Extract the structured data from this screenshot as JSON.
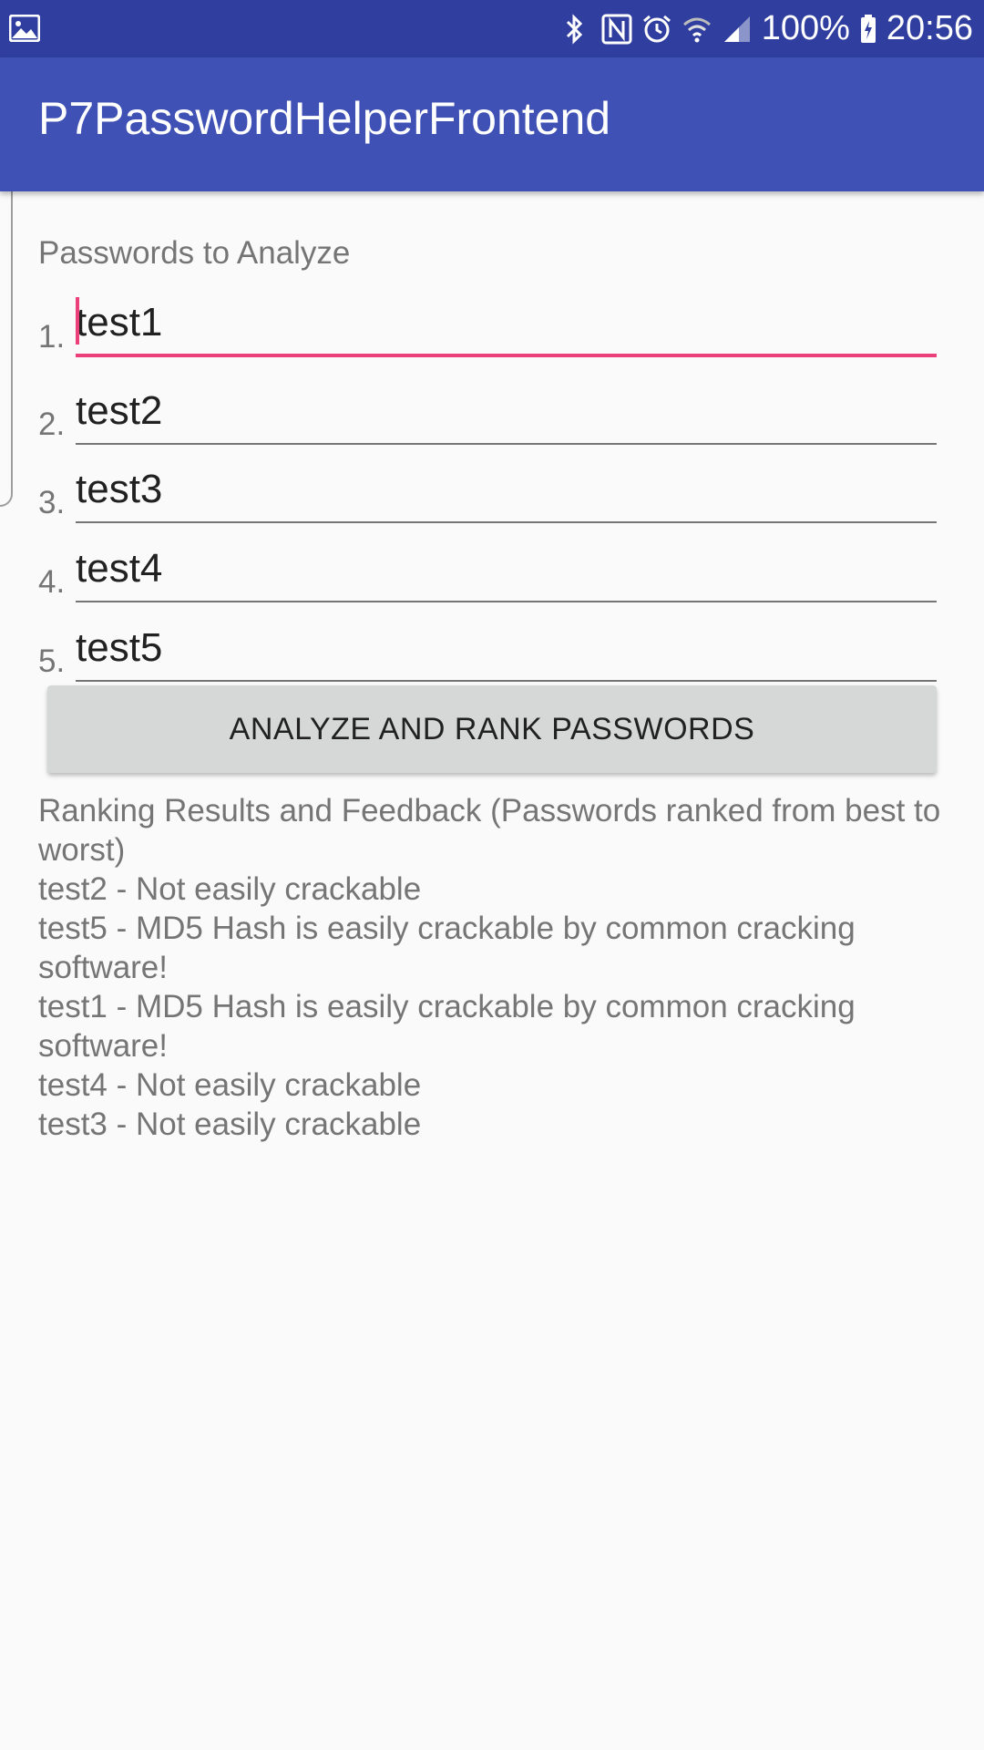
{
  "status_bar": {
    "battery": "100%",
    "time": "20:56",
    "left_icon": "image-icon",
    "icons": [
      "bluetooth-icon",
      "nfc-icon",
      "alarm-icon",
      "wifi-icon",
      "signal-icon",
      "battery-charging-icon"
    ]
  },
  "app_bar": {
    "title": "P7PasswordHelperFrontend"
  },
  "form": {
    "section_label": "Passwords to Analyze",
    "passwords": [
      {
        "number": "1.",
        "value": "test1"
      },
      {
        "number": "2.",
        "value": "test2"
      },
      {
        "number": "3.",
        "value": "test3"
      },
      {
        "number": "4.",
        "value": "test4"
      },
      {
        "number": "5.",
        "value": "test5"
      }
    ],
    "analyze_label": "ANALYZE AND RANK PASSWORDS"
  },
  "results": {
    "heading": "Ranking Results and Feedback (Passwords ranked from best to worst)",
    "lines": [
      "test2 - Not easily crackable",
      "test5 - MD5 Hash is easily crackable by common cracking software!",
      "test1 - MD5 Hash is easily crackable by common cracking software!",
      "test4 - Not easily crackable",
      "test3 - Not easily crackable"
    ]
  },
  "colors": {
    "status_bar": "#303f9f",
    "app_bar": "#3f51b5",
    "accent": "#ec407a",
    "button": "#d6d7d7"
  }
}
